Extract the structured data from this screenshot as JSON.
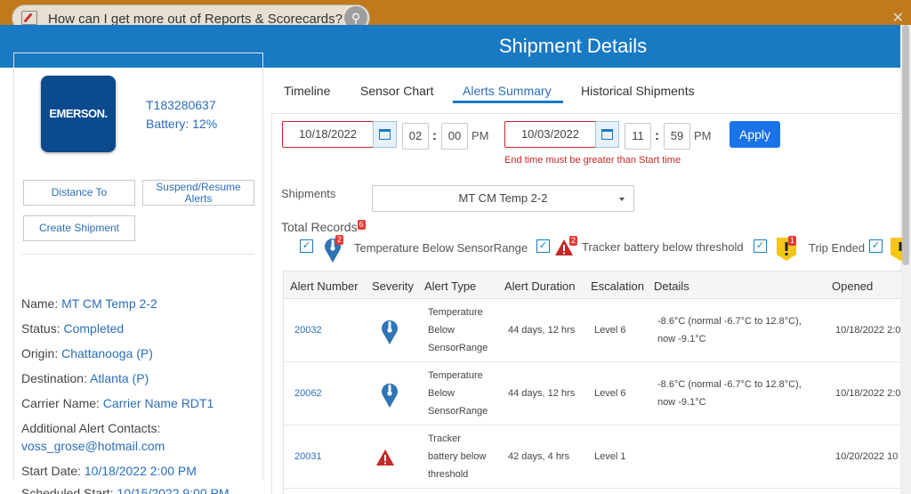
{
  "background": {
    "search_question": "How can I get more out of Reports & Scorecards?",
    "search_icon": "search-icon",
    "close_icon": "close-icon"
  },
  "modal": {
    "title": "Shipment Details"
  },
  "left_panel": {
    "logo_text": "EMERSON.",
    "device_id": "T183280637",
    "battery": "Battery: 12%",
    "buttons": {
      "distance_to": "Distance To",
      "suspend_resume": "Suspend/Resume Alerts",
      "create_shipment": "Create Shipment"
    },
    "info": [
      {
        "label": "Name:",
        "value": "MT CM Temp 2-2"
      },
      {
        "label": "Status:",
        "value": "Completed"
      },
      {
        "label": "Origin:",
        "value": "Chattanooga (P)"
      },
      {
        "label": "Destination:",
        "value": "Atlanta (P)"
      },
      {
        "label": "Carrier Name:",
        "value": "Carrier Name RDT1"
      },
      {
        "label": "Additional Alert Contacts:",
        "value": "voss_grose@hotmail.com"
      },
      {
        "label": "Start Date:",
        "value": "10/18/2022 2:00 PM"
      },
      {
        "label": "Scheduled Start:",
        "value": "10/15/2022 9:00 PM"
      }
    ]
  },
  "tabs": [
    "Timeline",
    "Sensor Chart",
    "Alerts Summary",
    "Historical Shipments"
  ],
  "active_tab": "Alerts Summary",
  "filters": {
    "start_date": "10/18/2022",
    "start_hour": "02",
    "start_minute": "00",
    "start_ampm": "PM",
    "end_date": "10/03/2022",
    "end_hour": "11",
    "end_minute": "59",
    "end_ampm": "PM",
    "apply_label": "Apply",
    "error_message": "End time must be greater than Start time",
    "colon": ":"
  },
  "shipments": {
    "label": "Shipments",
    "selected": "MT CM Temp 2-2"
  },
  "total_records": {
    "label": "Total Records",
    "count": "6"
  },
  "alert_filters": [
    {
      "label": "Temperature Below SensorRange",
      "count": "2",
      "icon": "thermometer-pin-icon"
    },
    {
      "label": "Tracker battery below threshold",
      "count": "2",
      "icon": "warning-triangle-icon"
    },
    {
      "label": "Trip Ended",
      "count": "1",
      "icon": "trip-ended-flag-icon"
    }
  ],
  "table": {
    "headers": [
      "Alert Number",
      "Severity",
      "Alert Type",
      "Alert Duration",
      "Escalation",
      "Details",
      "Opened"
    ],
    "rows": [
      {
        "alert_number": "20032",
        "severity_icon": "thermometer-pin-icon",
        "type_lines": [
          "Temperature",
          "Below",
          "SensorRange"
        ],
        "duration": "44 days, 12 hrs",
        "escalation": "Level 6",
        "details_lines": [
          "-8.6°C (normal -6.7°C to 12.8°C),",
          "now -9.1°C"
        ],
        "opened": "10/18/2022 2:0"
      },
      {
        "alert_number": "20062",
        "severity_icon": "thermometer-pin-icon",
        "type_lines": [
          "Temperature",
          "Below",
          "SensorRange"
        ],
        "duration": "44 days, 12 hrs",
        "escalation": "Level 6",
        "details_lines": [
          "-8.6°C (normal -6.7°C to 12.8°C),",
          "now -9.1°C"
        ],
        "opened": "10/18/2022 2:0"
      },
      {
        "alert_number": "20031",
        "severity_icon": "warning-triangle-icon",
        "type_lines": [
          "Tracker",
          "battery below",
          "threshold"
        ],
        "duration": "42 days, 4 hrs",
        "escalation": "Level 1",
        "details_lines": [],
        "opened": "10/20/2022 10"
      }
    ]
  },
  "colors": {
    "header_blue": "#1979c3",
    "link_blue": "#2a6ebb",
    "error_red": "#c62828",
    "apply_blue": "#1a73e8"
  }
}
